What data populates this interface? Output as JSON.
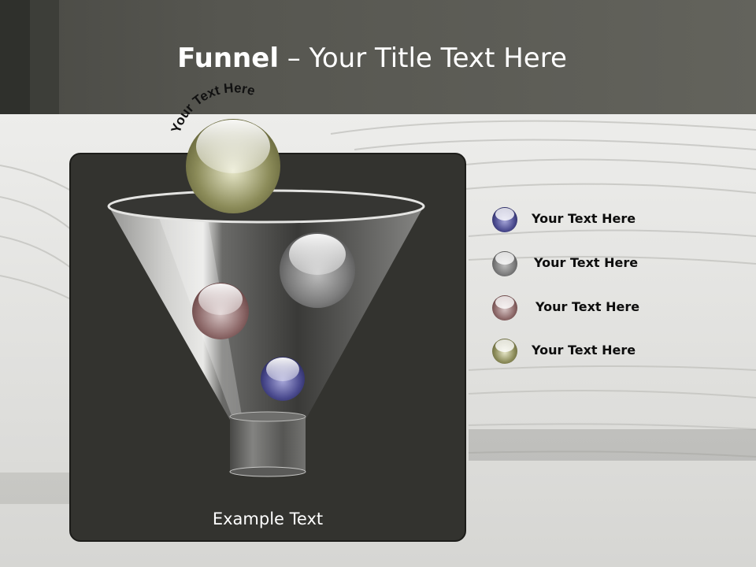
{
  "slide": {
    "title_bold": "Funnel",
    "title_rest": " – Your Title Text Here",
    "curved_label": "Your Text Here",
    "example_text": "Example Text"
  },
  "legend": [
    {
      "label": "Your  Text Here",
      "color": "#4a4a8a"
    },
    {
      "label": "Your  Text Here",
      "color": "#6c6c6c"
    },
    {
      "label": "Your  Text Here",
      "color": "#8a6868"
    },
    {
      "label": "Your  Text Here",
      "color": "#7a7a4c"
    }
  ],
  "colors": {
    "header": "#565650",
    "panel": "#33332f",
    "ball_olive": "#8a8a58",
    "ball_gray": "#7a7a7a",
    "ball_rose": "#8a6464",
    "ball_blue": "#4a4a8c"
  }
}
